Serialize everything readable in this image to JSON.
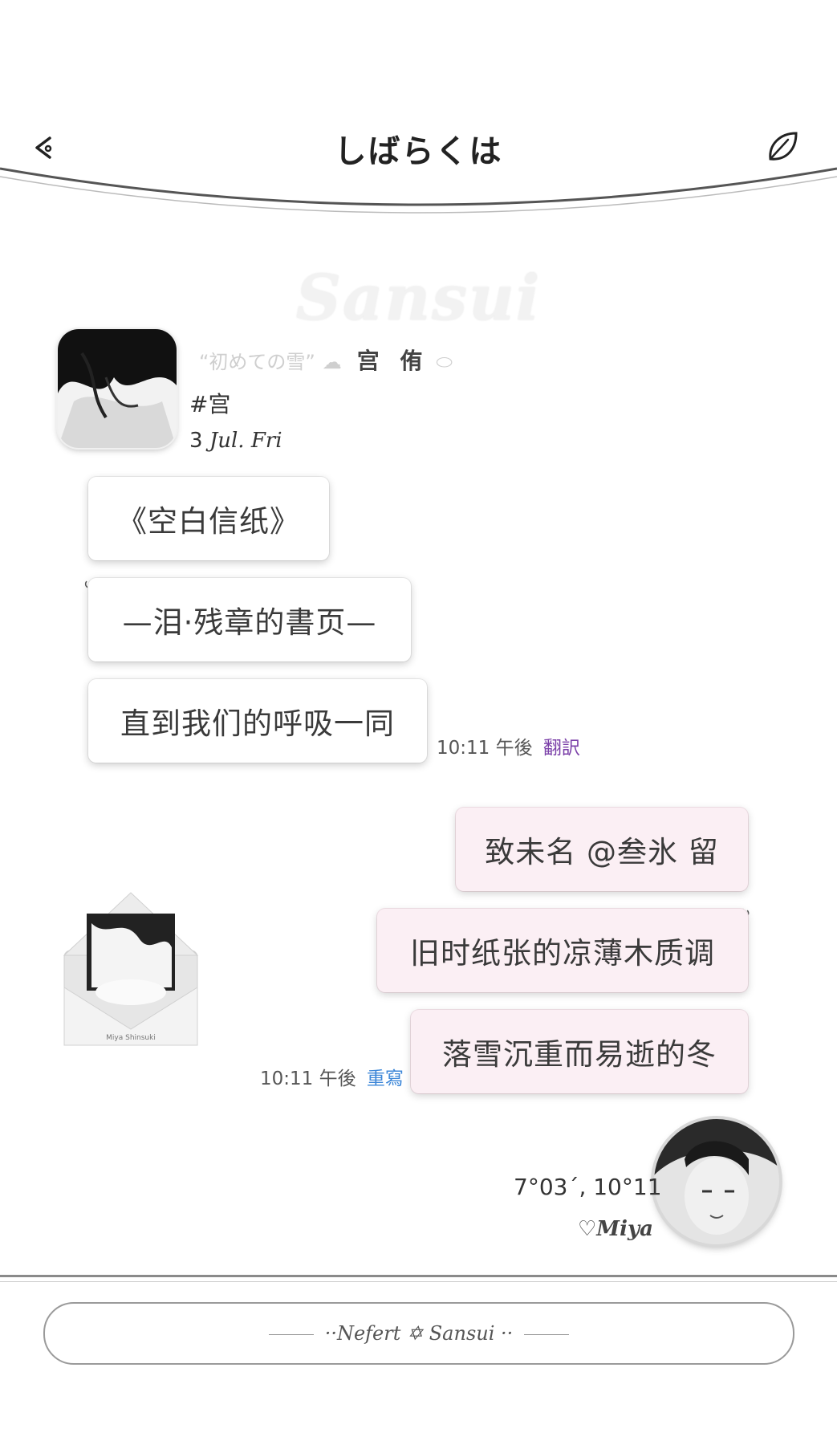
{
  "header": {
    "title": "しばらくは",
    "watermark": "Sansui"
  },
  "sender": {
    "decor_text": "“初めての雪”",
    "name": "宫 侑",
    "tag": "#宫",
    "date_day": "3",
    "date_rest": "Jul. Fri"
  },
  "incoming": {
    "messages": [
      "《空白信纸》",
      "—泪·残章的書页—",
      "直到我们的呼吸一同"
    ],
    "time": "10:11 午後",
    "action": "翻訳"
  },
  "outgoing": {
    "messages": [
      "致未名 @叁氷 留",
      "旧时纸张的凉薄木质调",
      "落雪沉重而易逝的冬"
    ],
    "time": "10:11 午後",
    "action": "重寫"
  },
  "sticker": {
    "caption": "Miya Shinsuki"
  },
  "signature": {
    "coords": "7°03´, 10°11",
    "name": "♡Miya"
  },
  "footer": {
    "input_text": "··Nefert ✡ Sansui ··"
  },
  "icons": {
    "back": "back-arrow-icon",
    "leaf": "leaf-icon"
  },
  "colors": {
    "outgoing_bubble": "#fbeff4",
    "incoming_bubble": "#ffffff",
    "translate_action": "#7a3fa8",
    "rewrite_action": "#3d87d8"
  }
}
